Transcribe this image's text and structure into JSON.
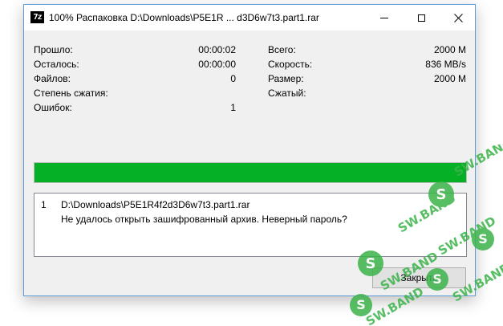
{
  "window": {
    "icon_text": "7z",
    "title": "100% Распаковка D:\\Downloads\\P5E1R ... d3D6w7t3.part1.rar"
  },
  "stats": {
    "left": [
      {
        "label": "Прошло:",
        "value": "00:00:02"
      },
      {
        "label": "Осталось:",
        "value": "00:00:00"
      },
      {
        "label": "Файлов:",
        "value": "0"
      },
      {
        "label": "Степень сжатия:",
        "value": ""
      },
      {
        "label": "Ошибок:",
        "value": "1"
      }
    ],
    "right": [
      {
        "label": "Всего:",
        "value": "2000 M"
      },
      {
        "label": "Скорость:",
        "value": "836 MB/s"
      },
      {
        "label": "Размер:",
        "value": "2000 M"
      },
      {
        "label": "Сжатый:",
        "value": ""
      }
    ]
  },
  "progress": {
    "fraction": 1.0,
    "color": "#06b025"
  },
  "messages": [
    {
      "num": "1",
      "text": "D:\\Downloads\\P5E1R4f2d3D6w7t3.part1.rar"
    },
    {
      "num": "",
      "text": "Не удалось открыть зашифрованный архив. Неверный пароль?"
    }
  ],
  "buttons": {
    "close_label": "Закрыть"
  },
  "watermark": {
    "text": "SW.BAND",
    "color": "#3cb34a"
  }
}
